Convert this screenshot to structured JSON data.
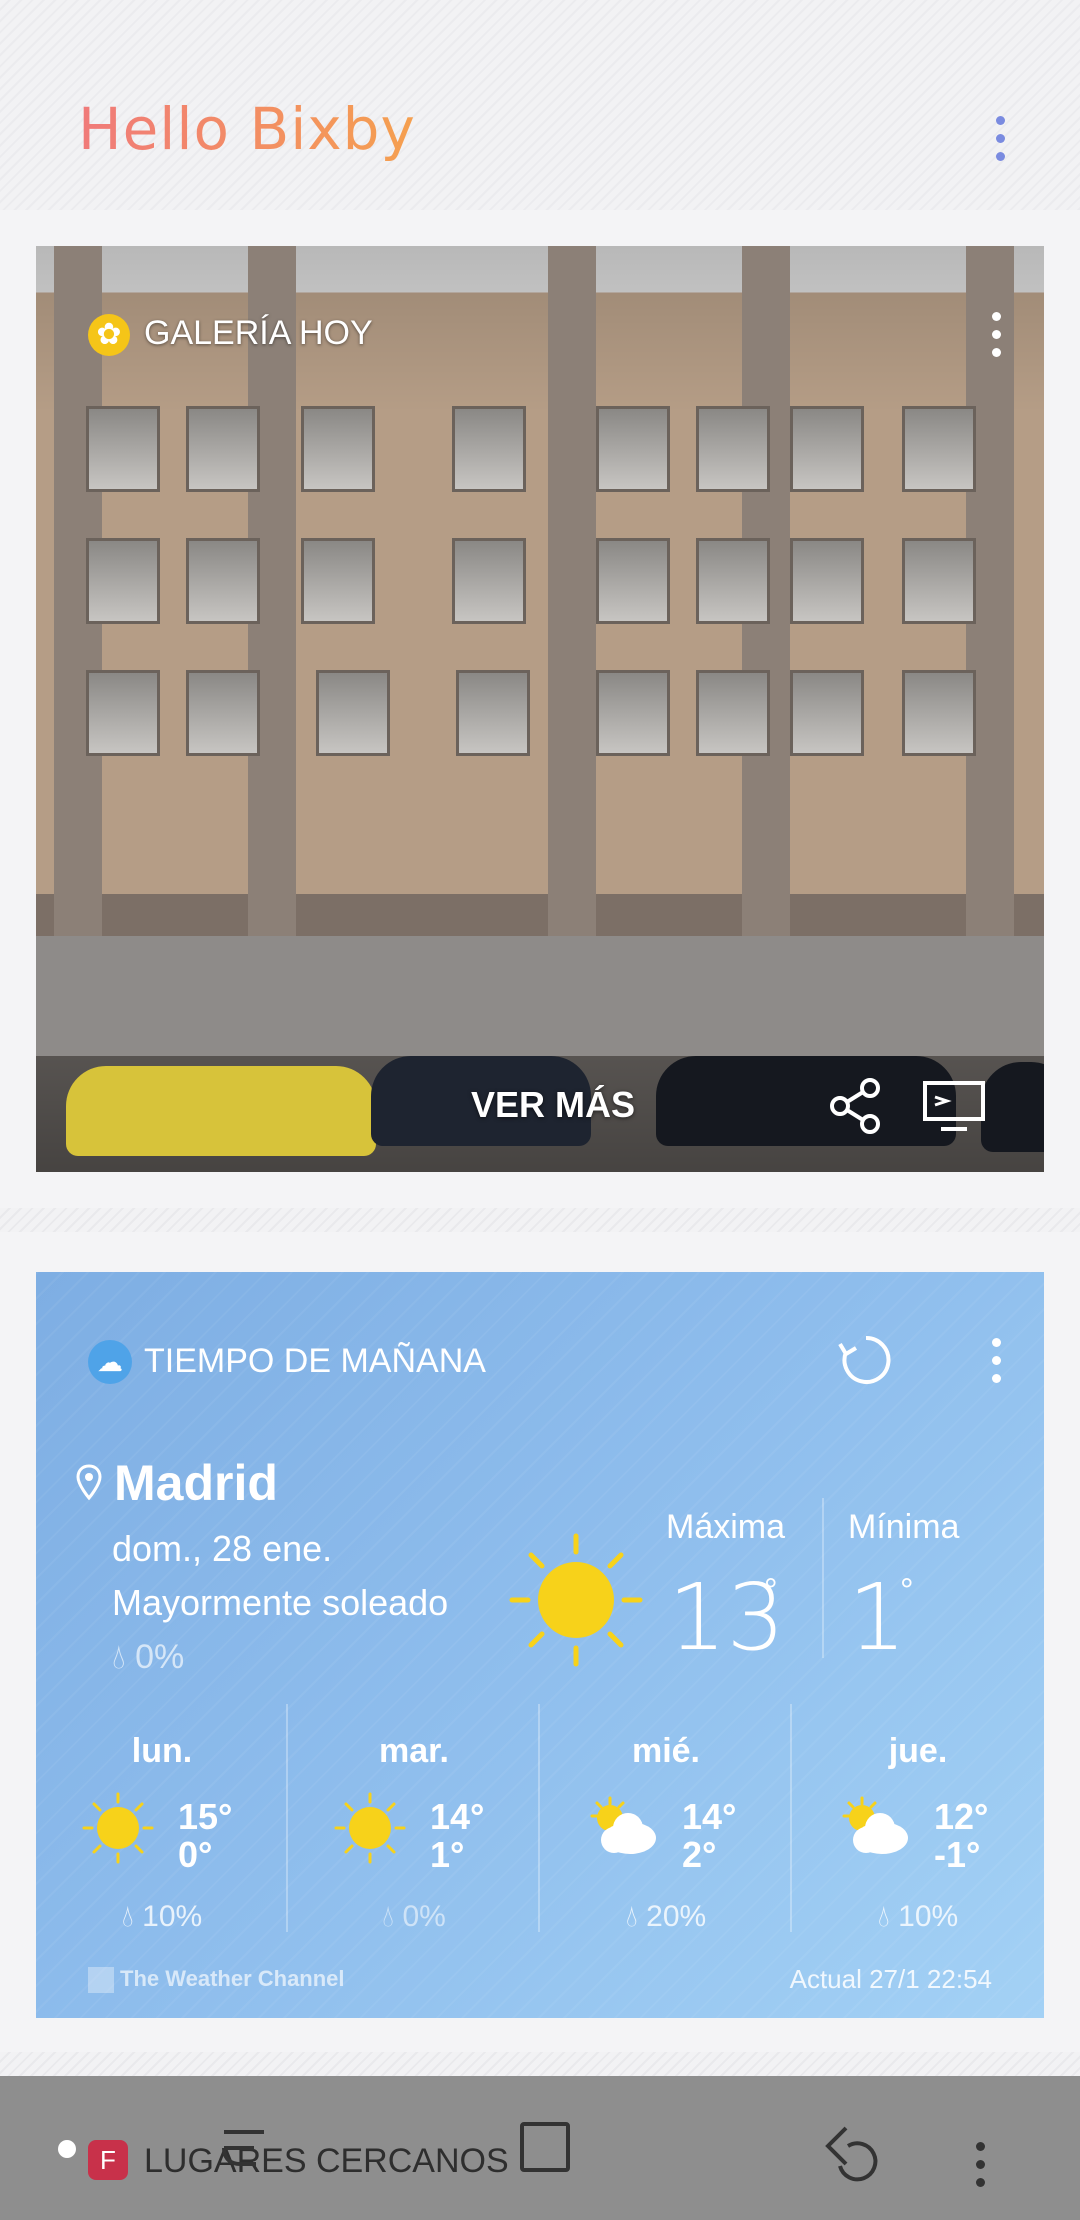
{
  "header": {
    "title": "Hello Bixby",
    "menu_icon": "vertical-dots-icon"
  },
  "gallery_card": {
    "label": "GALERÍA HOY",
    "icon": "gallery-flower-icon",
    "action_label": "VER MÁS",
    "share_icon": "share-icon",
    "cast_icon": "cast-icon"
  },
  "weather_card": {
    "label": "TIEMPO DE MAÑANA",
    "icon": "weather-cloud-icon",
    "city": "Madrid",
    "date": "dom., 28 ene.",
    "condition": "Mayormente soleado",
    "precip": "0%",
    "max_label": "Máxima",
    "min_label": "Mínima",
    "max_value": "13",
    "min_value": "1",
    "degree": "°",
    "forecast": [
      {
        "day": "lun.",
        "hi": "15°",
        "lo": "0°",
        "precip": "10%",
        "icon": "sunny-icon"
      },
      {
        "day": "mar.",
        "hi": "14°",
        "lo": "1°",
        "precip": "0%",
        "icon": "sunny-icon"
      },
      {
        "day": "mié.",
        "hi": "14°",
        "lo": "2°",
        "precip": "20%",
        "icon": "partly-cloudy-icon"
      },
      {
        "day": "jue.",
        "hi": "12°",
        "lo": "-1°",
        "precip": "10%",
        "icon": "partly-cloudy-icon"
      }
    ],
    "provider": "The Weather Channel",
    "updated": "Actual 27/1 22:54"
  },
  "nearby_card": {
    "label": "LUGARES CERCANOS",
    "icon": "foursquare-icon"
  },
  "colors": {
    "brand_gradient_start": "#f07a7a",
    "brand_gradient_end": "#f5a04f",
    "menu_dots": "#7a8be0",
    "weather_bg": "#8dbcec",
    "sun": "#f7d21a"
  }
}
